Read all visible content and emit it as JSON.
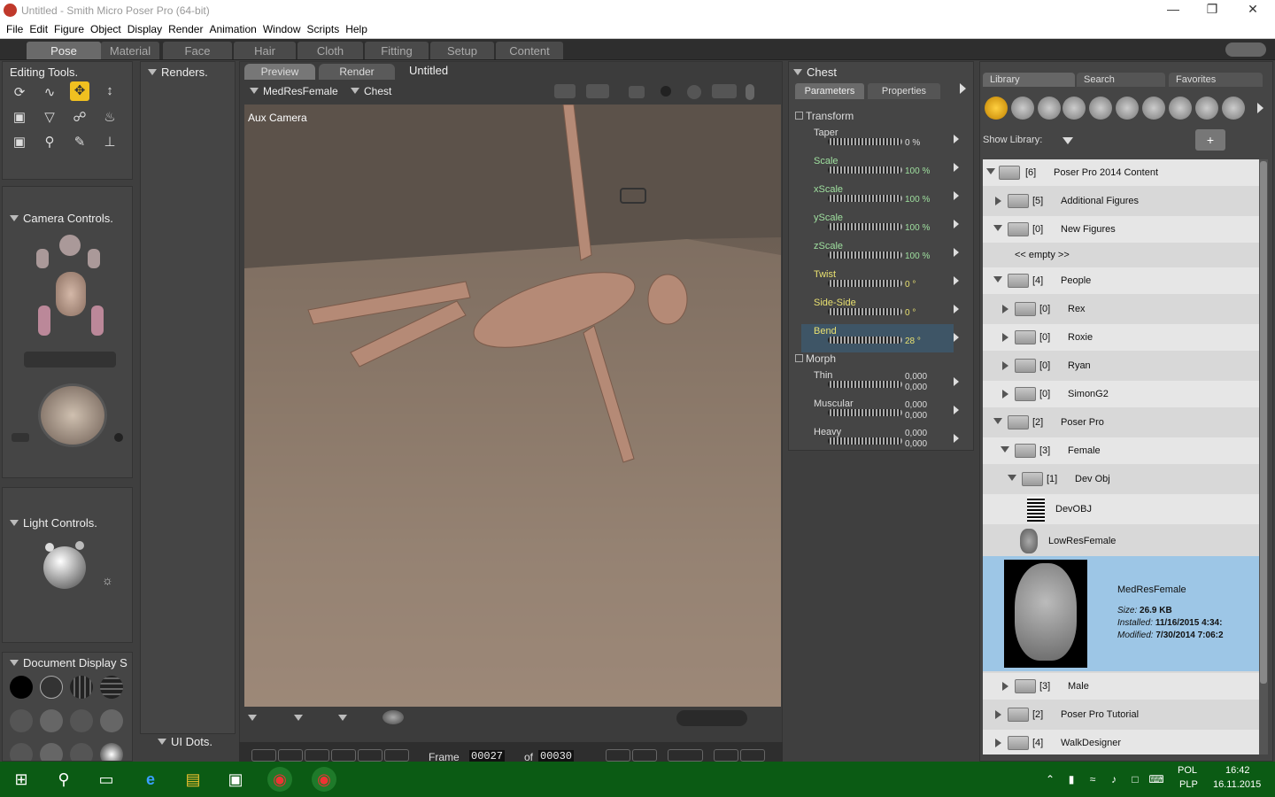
{
  "window": {
    "title": "Untitled - Smith Micro Poser Pro  (64-bit)"
  },
  "menu": [
    "File",
    "Edit",
    "Figure",
    "Object",
    "Display",
    "Render",
    "Animation",
    "Window",
    "Scripts",
    "Help"
  ],
  "rooms": [
    "Pose",
    "Material",
    "Face",
    "Hair",
    "Cloth",
    "Fitting",
    "Setup",
    "Content"
  ],
  "panels": {
    "editing_tools": "Editing Tools.",
    "renders": "Renders.",
    "camera_controls": "Camera Controls.",
    "light_controls": "Light Controls.",
    "document_display": "Document Display S",
    "ui_dots": "UI Dots."
  },
  "viewport": {
    "tabs": [
      "Preview",
      "Render"
    ],
    "doc_title": "Untitled",
    "figure_menu": "MedResFemale",
    "actor_menu": "Chest",
    "camera_label": "Aux Camera"
  },
  "timeline": {
    "frame_label": "Frame",
    "frame_value": "00027",
    "of_label": "of",
    "total_frames": "00030"
  },
  "parameters": {
    "actor": "Chest",
    "tabs": [
      "Parameters",
      "Properties"
    ],
    "groups": {
      "transform": "Transform",
      "morph": "Morph"
    },
    "transform": [
      {
        "name": "Taper",
        "value": "0 %"
      },
      {
        "name": "Scale",
        "value": "100 %"
      },
      {
        "name": "xScale",
        "value": "100 %"
      },
      {
        "name": "yScale",
        "value": "100 %"
      },
      {
        "name": "zScale",
        "value": "100 %"
      },
      {
        "name": "Twist",
        "value": "0 °"
      },
      {
        "name": "Side-Side",
        "value": "0 °"
      },
      {
        "name": "Bend",
        "value": "28 °"
      }
    ],
    "morph": [
      {
        "name": "Thin",
        "v1": "0,000",
        "v2": "0,000"
      },
      {
        "name": "Muscular",
        "v1": "0,000",
        "v2": "0,000"
      },
      {
        "name": "Heavy",
        "v1": "0,000",
        "v2": "0,000"
      }
    ]
  },
  "library": {
    "tabs": [
      "Library",
      "Search",
      "Favorites"
    ],
    "show_library": "Show Library:",
    "tree": [
      {
        "count": "[6]",
        "name": "Poser Pro 2014 Content"
      },
      {
        "count": "[5]",
        "name": "Additional Figures"
      },
      {
        "count": "[0]",
        "name": "New Figures"
      },
      {
        "empty": "<< empty >>"
      },
      {
        "count": "[4]",
        "name": "People"
      },
      {
        "count": "[0]",
        "name": "Rex"
      },
      {
        "count": "[0]",
        "name": "Roxie"
      },
      {
        "count": "[0]",
        "name": "Ryan"
      },
      {
        "count": "[0]",
        "name": "SimonG2"
      },
      {
        "count": "[2]",
        "name": "Poser Pro"
      },
      {
        "count": "[3]",
        "name": "Female"
      },
      {
        "count": "[1]",
        "name": "Dev Obj"
      },
      {
        "name": "DevOBJ"
      },
      {
        "name": "LowResFemale"
      },
      {
        "count": "[3]",
        "name": "Male"
      },
      {
        "count": "[2]",
        "name": "Poser Pro Tutorial"
      },
      {
        "count": "[4]",
        "name": "WalkDesigner"
      }
    ],
    "selected": {
      "name": "MedResFemale",
      "size_label": "Size:",
      "size": "26.9 KB",
      "installed_label": "Installed:",
      "installed": "11/16/2015 4:34:",
      "modified_label": "Modified:",
      "modified": "7/30/2014 7:06:2"
    }
  },
  "taskbar": {
    "lang1": "POL",
    "lang2": "PLP",
    "time": "16:42",
    "date": "16.11.2015"
  },
  "colors": {
    "tool_active": "#f0c020",
    "selected_row": "#9dc6e6",
    "title_green": "#9fe09f",
    "value_yellow": "#e8e070",
    "taskbar": "#0b5b14"
  }
}
